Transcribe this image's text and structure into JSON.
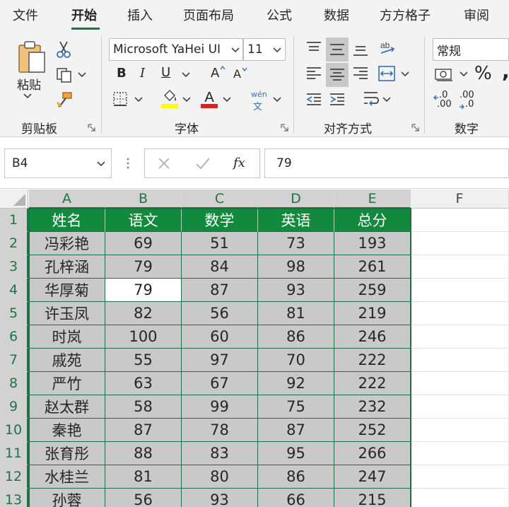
{
  "tabs": [
    {
      "label": "文件",
      "active": false
    },
    {
      "label": "开始",
      "active": true
    },
    {
      "label": "插入",
      "active": false
    },
    {
      "label": "页面布局",
      "active": false
    },
    {
      "label": "公式",
      "active": false
    },
    {
      "label": "数据",
      "active": false
    },
    {
      "label": "方方格子",
      "active": false
    },
    {
      "label": "审阅",
      "active": false
    }
  ],
  "ribbon": {
    "clipboard": {
      "paste_label": "粘贴",
      "group_label": "剪贴板"
    },
    "font": {
      "font_name": "Microsoft YaHei UI",
      "font_size": "11",
      "bold": "B",
      "italic": "I",
      "underline": "U",
      "grow": "A",
      "shrink": "A",
      "phonetic_top": "wén",
      "phonetic_bottom": "文",
      "group_label": "字体"
    },
    "alignment": {
      "group_label": "对齐方式"
    },
    "number": {
      "format": "常规",
      "percent": "%",
      "comma": ",",
      "inc_top": ".0",
      "inc_bottom": ".00",
      "dec_top": ".00",
      "dec_bottom": ".0",
      "group_label": "数字"
    },
    "colors": {
      "accent": "#217346",
      "highlight": "#ffff00",
      "font_color": "#e02020"
    }
  },
  "formula_bar": {
    "name_box": "B4",
    "fx": "fx",
    "value": "79"
  },
  "grid": {
    "columns": [
      "A",
      "B",
      "C",
      "D",
      "E",
      "F"
    ],
    "rows": [
      "1",
      "2",
      "3",
      "4",
      "5",
      "6",
      "7",
      "8",
      "9",
      "10",
      "11",
      "12",
      "13"
    ],
    "header_row": [
      "姓名",
      "语文",
      "数学",
      "英语",
      "总分"
    ],
    "data": [
      [
        "冯彩艳",
        "69",
        "51",
        "73",
        "193"
      ],
      [
        "孔梓涵",
        "79",
        "84",
        "98",
        "261"
      ],
      [
        "华厚菊",
        "79",
        "87",
        "93",
        "259"
      ],
      [
        "许玉凤",
        "82",
        "56",
        "81",
        "219"
      ],
      [
        "时岚",
        "100",
        "60",
        "86",
        "246"
      ],
      [
        "戚苑",
        "55",
        "97",
        "70",
        "222"
      ],
      [
        "严竹",
        "63",
        "67",
        "92",
        "222"
      ],
      [
        "赵太群",
        "58",
        "99",
        "75",
        "232"
      ],
      [
        "秦艳",
        "87",
        "78",
        "87",
        "252"
      ],
      [
        "张育彤",
        "88",
        "83",
        "95",
        "266"
      ],
      [
        "水桂兰",
        "81",
        "80",
        "86",
        "247"
      ],
      [
        "孙蓉",
        "56",
        "93",
        "66",
        "215"
      ]
    ],
    "header_fill": "#128a3e",
    "data_fill": "#c9c9c9",
    "active_cell": "B4"
  }
}
